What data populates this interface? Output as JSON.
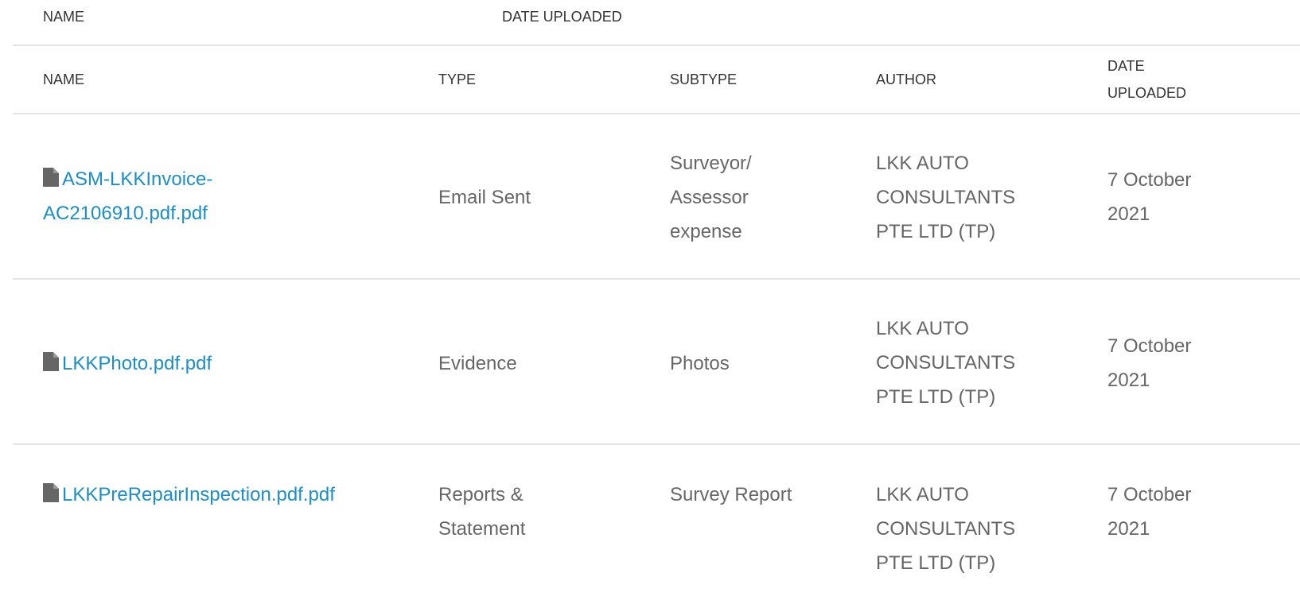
{
  "top_header": {
    "name": "NAME",
    "date_uploaded": "DATE UPLOADED"
  },
  "columns": {
    "name": "NAME",
    "type": "TYPE",
    "subtype": "SUBTYPE",
    "author": "AUTHOR",
    "date_line1": "DATE",
    "date_line2": "UPLOADED"
  },
  "rows": [
    {
      "name_line1": "ASM-LKKInvoice-",
      "name_line2": "AC2106910.pdf.pdf",
      "type_line1": "Email Sent",
      "type_line2": "",
      "subtype_line1": "Surveyor/",
      "subtype_line2": "Assessor",
      "subtype_line3": "expense",
      "author_line1": "LKK AUTO",
      "author_line2": "CONSULTANTS",
      "author_line3": "PTE LTD (TP)",
      "date_line1": "7 October",
      "date_line2": "2021"
    },
    {
      "name_line1": "LKKPhoto.pdf.pdf",
      "name_line2": "",
      "type_line1": "Evidence",
      "type_line2": "",
      "subtype_line1": "Photos",
      "subtype_line2": "",
      "subtype_line3": "",
      "author_line1": "LKK AUTO",
      "author_line2": "CONSULTANTS",
      "author_line3": "PTE LTD (TP)",
      "date_line1": "7 October",
      "date_line2": "2021"
    },
    {
      "name_line1": "LKKPreRepairInspection.pdf.pdf",
      "name_line2": "",
      "type_line1": "Reports &",
      "type_line2": "Statement",
      "subtype_line1": "Survey Report",
      "subtype_line2": "",
      "subtype_line3": "",
      "author_line1": "LKK AUTO",
      "author_line2": "CONSULTANTS",
      "author_line3": "PTE LTD (TP)",
      "date_line1": "7 October",
      "date_line2": "2021"
    }
  ],
  "icons": {
    "file": "file-icon"
  },
  "colors": {
    "link": "#1a8fc7",
    "text": "#666666",
    "header_text": "#333333",
    "divider": "#e6e6e6",
    "icon": "#666666"
  }
}
